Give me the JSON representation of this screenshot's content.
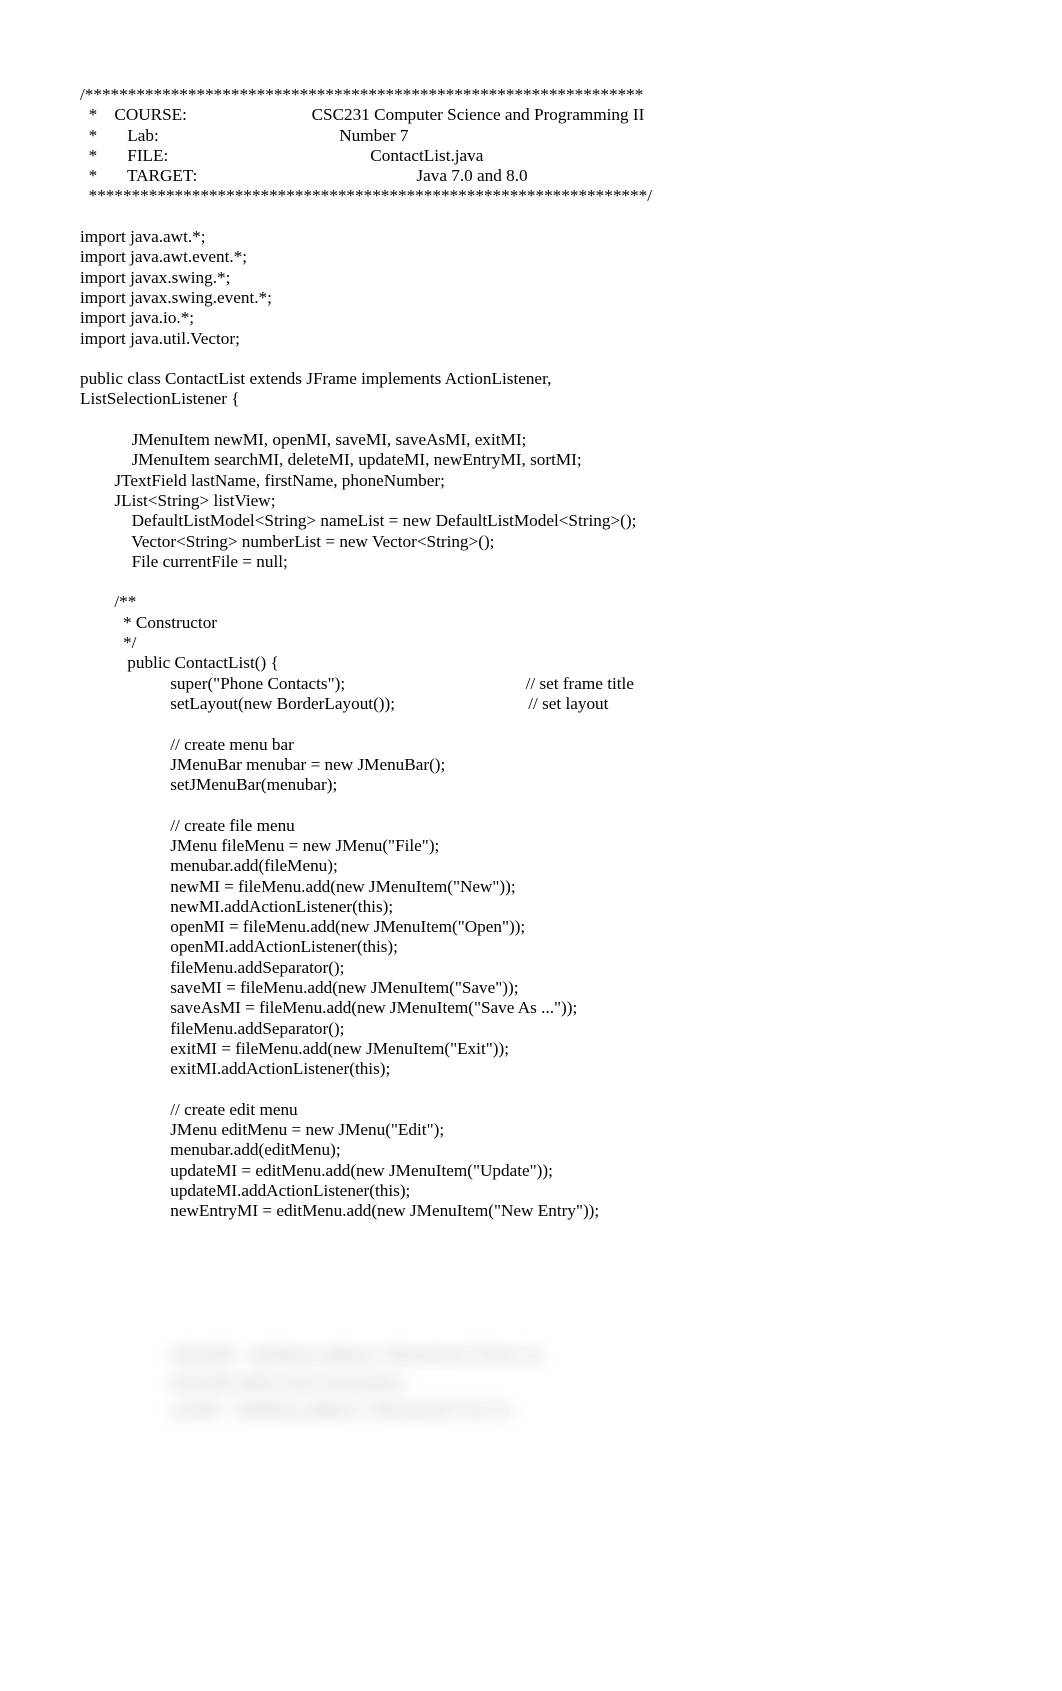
{
  "code_text": "/*****************************************************************\n  *    COURSE:                             CSC231 Computer Science and Programming II\n  *       Lab:                                          Number 7\n  *       FILE:                                               ContactList.java\n  *       TARGET:                                                   Java 7.0 and 8.0\n  *****************************************************************/\n\nimport java.awt.*;\nimport java.awt.event.*;\nimport javax.swing.*;\nimport javax.swing.event.*;\nimport java.io.*;\nimport java.util.Vector;\n\npublic class ContactList extends JFrame implements ActionListener,\nListSelectionListener {\n\n            JMenuItem newMI, openMI, saveMI, saveAsMI, exitMI;\n            JMenuItem searchMI, deleteMI, updateMI, newEntryMI, sortMI;\n        JTextField lastName, firstName, phoneNumber;\n        JList<String> listView;\n            DefaultListModel<String> nameList = new DefaultListModel<String>();\n            Vector<String> numberList = new Vector<String>();\n            File currentFile = null;\n\n        /**\n          * Constructor\n          */\n           public ContactList() {\n                     super(\"Phone Contacts\");                                          // set frame title\n                     setLayout(new BorderLayout());                               // set layout\n\n                     // create menu bar\n                     JMenuBar menubar = new JMenuBar();\n                     setJMenuBar(menubar);\n\n                     // create file menu\n                     JMenu fileMenu = new JMenu(\"File\");\n                     menubar.add(fileMenu);\n                     newMI = fileMenu.add(new JMenuItem(\"New\"));\n                     newMI.addActionListener(this);\n                     openMI = fileMenu.add(new JMenuItem(\"Open\"));\n                     openMI.addActionListener(this);\n                     fileMenu.addSeparator();\n                     saveMI = fileMenu.add(new JMenuItem(\"Save\"));\n                     saveAsMI = fileMenu.add(new JMenuItem(\"Save As ...\"));\n                     fileMenu.addSeparator();\n                     exitMI = fileMenu.add(new JMenuItem(\"Exit\"));\n                     exitMI.addActionListener(this);\n\n                     // create edit menu\n                     JMenu editMenu = new JMenu(\"Edit\");\n                     menubar.add(editMenu);\n                     updateMI = editMenu.add(new JMenuItem(\"Update\"));\n                     updateMI.addActionListener(this);\n                     newEntryMI = editMenu.add(new JMenuItem(\"New Entry\"));",
  "blur_text": "                     deleteMI = editMenu.add(new JMenuItem(\"Delete\"));\n                     deleteMI.addActionListener(this);\n                     sortMI = editMenu.add(new JMenuItem(\"Sort\"));"
}
